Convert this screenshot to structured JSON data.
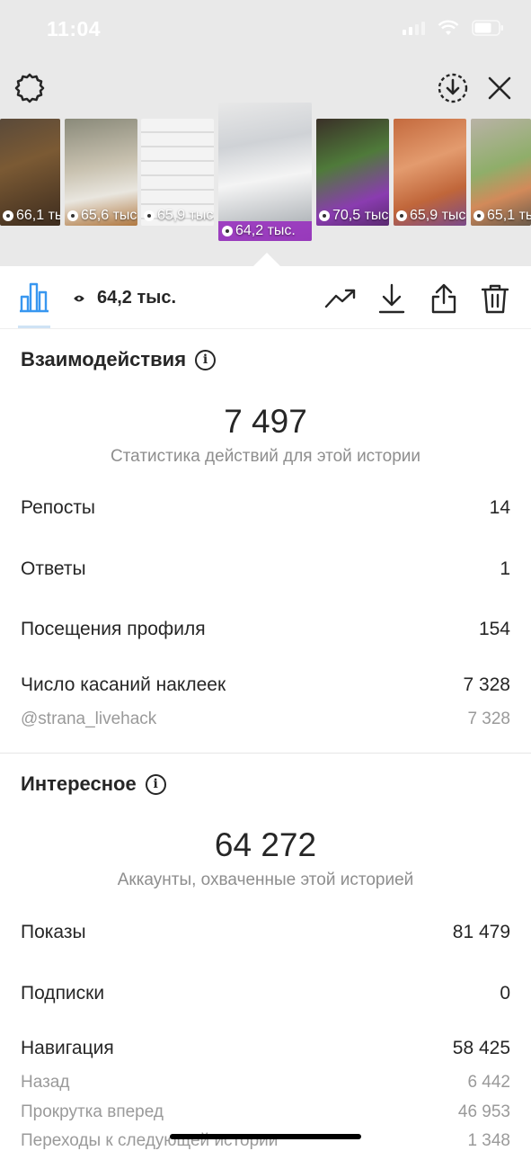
{
  "status_bar": {
    "time": "11:04"
  },
  "thumbnails": [
    {
      "views": "66,1 тыс.",
      "selected": false
    },
    {
      "views": "65,6 тыс.",
      "selected": false
    },
    {
      "views": "65,9 тыс.",
      "selected": false
    },
    {
      "views": "64,2 тыс.",
      "selected": true
    },
    {
      "views": "70,5 тыс.",
      "selected": false
    },
    {
      "views": "65,9 тыс.",
      "selected": false
    },
    {
      "views": "65,1 тыс.",
      "selected": false
    }
  ],
  "toolbar": {
    "views": "64,2 тыс."
  },
  "interactions": {
    "title": "Взаимодействия",
    "total": "7 497",
    "caption": "Статистика действий для этой истории",
    "rows": [
      {
        "label": "Репосты",
        "value": "14"
      },
      {
        "label": "Ответы",
        "value": "1"
      },
      {
        "label": "Посещения профиля",
        "value": "154"
      },
      {
        "label": "Число касаний наклеек",
        "value": "7 328"
      }
    ],
    "sub_rows": [
      {
        "label": "@strana_livehack",
        "value": "7 328"
      }
    ]
  },
  "discovery": {
    "title": "Интересное",
    "total": "64 272",
    "caption": "Аккаунты, охваченные этой историей",
    "rows": [
      {
        "label": "Показы",
        "value": "81 479"
      },
      {
        "label": "Подписки",
        "value": "0"
      },
      {
        "label": "Навигация",
        "value": "58 425"
      }
    ],
    "sub_rows": [
      {
        "label": "Назад",
        "value": "6 442"
      },
      {
        "label": "Прокрутка вперед",
        "value": "46 953"
      },
      {
        "label": "Переходы к следующей истории",
        "value": "1 348"
      }
    ]
  }
}
